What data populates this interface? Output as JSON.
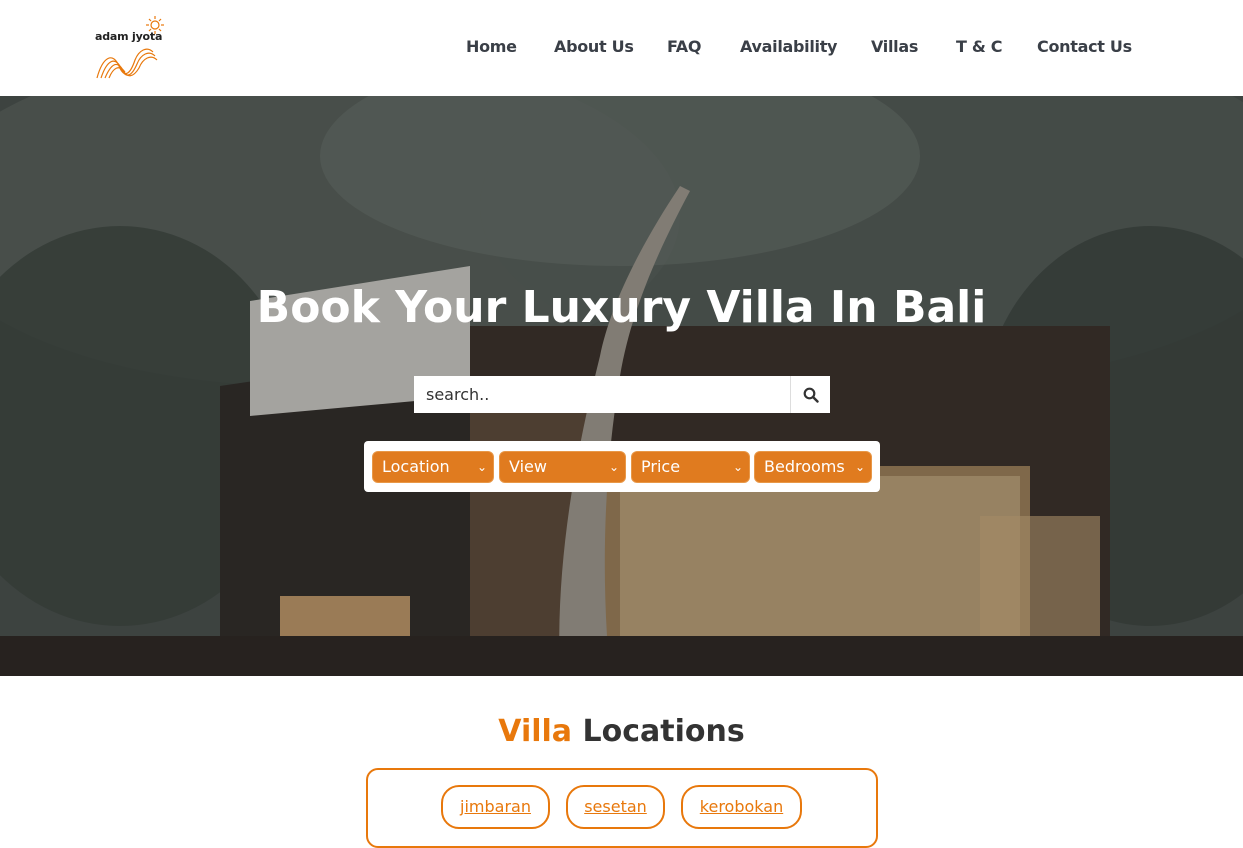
{
  "header": {
    "logo_text": "adam jyota",
    "nav": [
      "Home",
      "About Us",
      "FAQ",
      "Availability",
      "Villas",
      "T & C",
      "Contact Us"
    ]
  },
  "hero": {
    "title": "Book Your Luxury Villa In Bali",
    "search_placeholder": "search..",
    "filters": [
      "Location",
      "View",
      "Price",
      "Bedrooms"
    ]
  },
  "locations": {
    "title_accent": "Villa",
    "title_rest": "Locations",
    "items": [
      "jimbaran",
      "sesetan",
      "kerobokan"
    ]
  },
  "colors": {
    "accent": "#e8780c",
    "nav_text": "#3a3f47"
  }
}
